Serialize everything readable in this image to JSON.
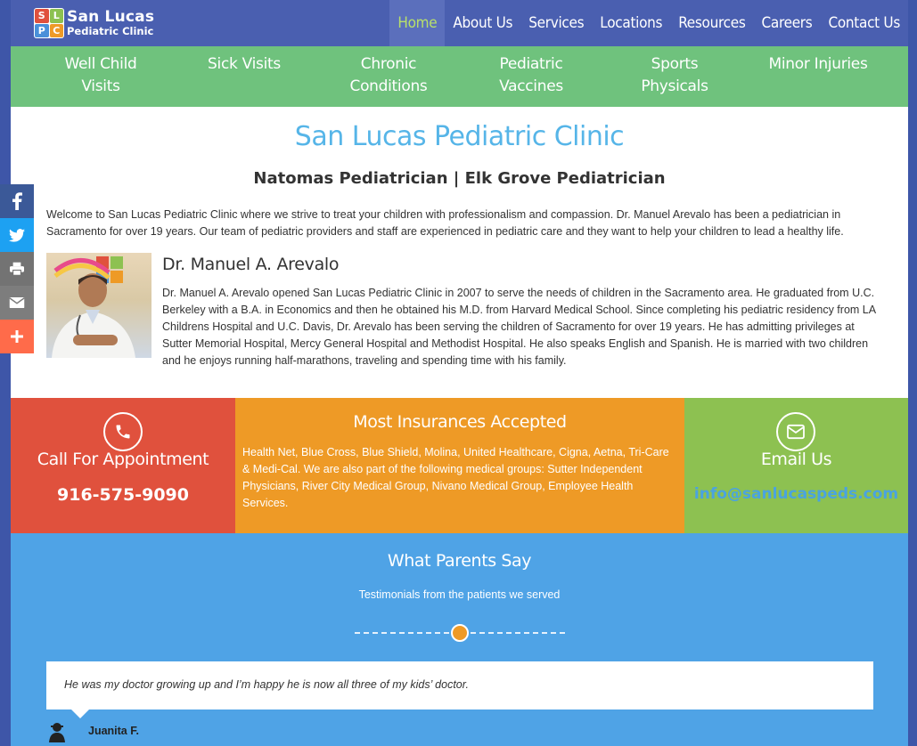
{
  "logo": {
    "letters": [
      "S",
      "L",
      "P",
      "C"
    ],
    "letter_colors": [
      "#e0513d",
      "#8dc151",
      "#4a90d9",
      "#ee9a26"
    ],
    "line1": "San Lucas",
    "line2": "Pediatric Clinic"
  },
  "nav": {
    "items": [
      {
        "label": "Home",
        "active": true
      },
      {
        "label": "About Us"
      },
      {
        "label": "Services"
      },
      {
        "label": "Locations"
      },
      {
        "label": "Resources"
      },
      {
        "label": "Careers"
      },
      {
        "label": "Contact Us"
      }
    ]
  },
  "services": [
    {
      "line1": "Well Child Visits",
      "line2": ""
    },
    {
      "line1": "Sick  Visits",
      "line2": ""
    },
    {
      "line1": "Chronic",
      "line2": "Conditions"
    },
    {
      "line1": "Pediatric",
      "line2": "Vaccines"
    },
    {
      "line1": "Sports Physicals",
      "line2": ""
    },
    {
      "line1": "Minor Injuries",
      "line2": ""
    }
  ],
  "main": {
    "title": "San Lucas Pediatric Clinic",
    "subtitle": "Natomas Pediatrician | Elk Grove Pediatrician",
    "intro": "Welcome to San Lucas Pediatric Clinic where we strive to treat your children with professionalism and compassion. Dr. Manuel Arevalo has been a pediatrician in Sacramento for over 19 years. Our team of pediatric providers and staff are experienced in pediatric care and they want to help your children to lead a healthy life.",
    "doctor_name": "Dr. Manuel A. Arevalo",
    "doctor_bio": "Dr. Manuel A. Arevalo opened San Lucas Pediatric Clinic in 2007 to serve the needs of children in the Sacramento area. He graduated from U.C. Berkeley with a B.A. in Economics and then he obtained his M.D. from Harvard Medical School. Since completing his pediatric residency from LA Childrens Hospital and U.C. Davis, Dr. Arevalo has been serving the children of Sacramento for over 19 years. He has admitting privileges at Sutter Memorial Hospital, Mercy General Hospital and Methodist Hospital. He also speaks English and Spanish. He is married with two children and he enjoys running half-marathons, traveling and spending time with his family."
  },
  "boxes": {
    "call": {
      "heading": "Call For Appointment",
      "phone": "916-575-9090",
      "icon": "phone-icon",
      "color": "#e0513d"
    },
    "insurance": {
      "heading": "Most Insurances Accepted",
      "text": "Health Net, Blue Cross, Blue Shield, Molina, United Healthcare, Cigna, Aetna, Tri-Care & Medi-Cal. We are also part of the following medical groups: Sutter Independent Physicians, River City Medical Group, Nivano Medical Group, Employee Health Services.",
      "color": "#ee9a26"
    },
    "email": {
      "heading": "Email Us",
      "address": "info@sanlucaspeds.com",
      "icon": "envelope-icon",
      "color": "#8dc151"
    }
  },
  "testimonials": {
    "heading": "What Parents Say",
    "subheading": "Testimonials from the patients we served",
    "quote": "He was my doctor growing up and I’m happy he is now all three of my kids’ doctor.",
    "reviewer": "Juanita F."
  },
  "share": [
    {
      "icon": "facebook-icon",
      "color": "#3b5998"
    },
    {
      "icon": "twitter-icon",
      "color": "#1da1f2"
    },
    {
      "icon": "print-icon",
      "color": "#737373"
    },
    {
      "icon": "email-icon",
      "color": "#7d7d7d"
    },
    {
      "icon": "plus-icon",
      "color": "#ff6b4a"
    }
  ],
  "colors": {
    "header": "#4a5fb0",
    "services_bar": "#6fc27d",
    "accent_blue": "#56b5e8",
    "active_nav": "#b8e06a",
    "testimonials_bg": "#4fa3e6"
  }
}
